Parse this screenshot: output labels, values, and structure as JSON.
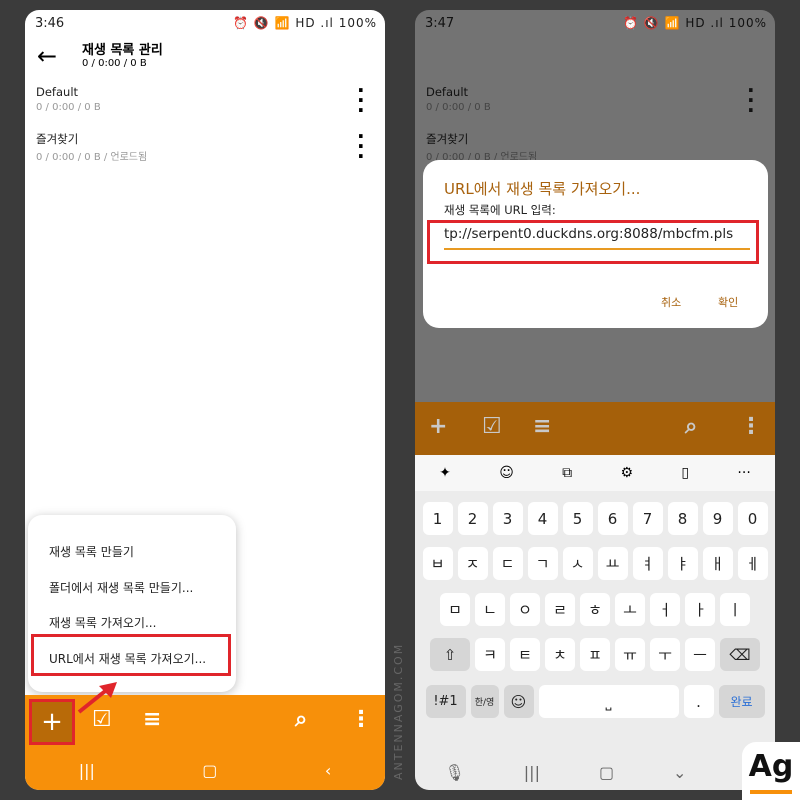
{
  "left": {
    "status": {
      "time": "3:46",
      "right": "⏰ 🔇 📶 HD .ıl 100%"
    },
    "header": {
      "title": "재생 목록 관리",
      "subtitle": "0 / 0:00 / 0 B"
    },
    "items": [
      {
        "name": "Default",
        "sub": "0 / 0:00 / 0 B"
      },
      {
        "name": "즐겨찾기",
        "sub": "0 / 0:00 / 0 B / 언로드됨"
      }
    ],
    "menu": [
      "재생 목록 만들기",
      "폴더에서 재생 목록 만들기...",
      "재생 목록 가져오기...",
      "URL에서 재생 목록 가져오기..."
    ]
  },
  "right": {
    "status": {
      "time": "3:47",
      "right": "⏰ 🔇 📶 HD .ıl 100%"
    },
    "items": [
      {
        "name": "Default",
        "sub": "0 / 0:00 / 0 B"
      },
      {
        "name": "즐겨찾기",
        "sub": "0 / 0:00 / 0 B / 언로드됨"
      }
    ],
    "dialog": {
      "title": "URL에서 재생 목록 가져오기...",
      "label": "재생 목록에 URL 입력:",
      "url": "tp://serpent0.duckdns.org:8088/mbcfm.pls",
      "cancel": "취소",
      "ok": "확인"
    },
    "keyboard": {
      "row1": [
        "1",
        "2",
        "3",
        "4",
        "5",
        "6",
        "7",
        "8",
        "9",
        "0"
      ],
      "row2": [
        "ㅂ",
        "ㅈ",
        "ㄷ",
        "ㄱ",
        "ㅅ",
        "ㅛ",
        "ㅕ",
        "ㅑ",
        "ㅐ",
        "ㅔ"
      ],
      "row3": [
        "ㅁ",
        "ㄴ",
        "ㅇ",
        "ㄹ",
        "ㅎ",
        "ㅗ",
        "ㅓ",
        "ㅏ",
        "ㅣ"
      ],
      "row4": [
        "ㅋ",
        "ㅌ",
        "ㅊ",
        "ㅍ",
        "ㅠ",
        "ㅜ",
        "ㅡ"
      ],
      "sym": "!#1",
      "lang": "한/영",
      "period": ".",
      "done": "완료"
    }
  },
  "watermark": "ANTENNAGOM.COM",
  "logo": "Ag",
  "colors": {
    "accent": "#f7900a",
    "highlight": "#e0252b",
    "dialog_text": "#a8620e"
  }
}
